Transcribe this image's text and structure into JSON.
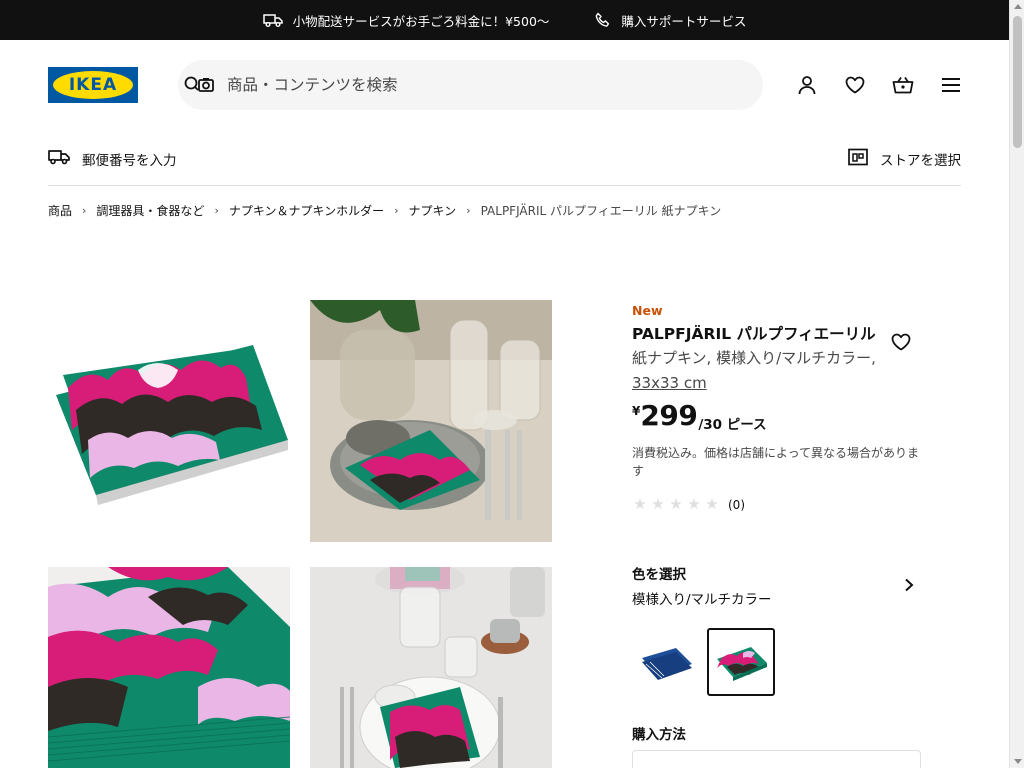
{
  "topbar": {
    "delivery_text": "小物配送サービスがお手ごろ料金に！¥500〜",
    "support_text": "購入サポートサービス"
  },
  "header": {
    "logo_text": "IKEA",
    "search_placeholder": "商品・コンテンツを検索",
    "postal_label": "郵便番号を入力",
    "store_label": "ストアを選択"
  },
  "breadcrumb": {
    "items": [
      "商品",
      "調理器具・食器など",
      "ナプキン＆ナプキンホルダー",
      "ナプキン"
    ],
    "current": "PALPFJÄRIL パルプフィエーリル 紙ナプキン"
  },
  "product": {
    "badge": "New",
    "name": "PALPFJÄRIL パルプフィエーリル",
    "description": "紙ナプキン, 模様入り/マルチカラー, ",
    "size": "33x33 cm",
    "currency": "¥",
    "price": "299",
    "unit": "/30 ピース",
    "tax_note": "消費税込み。価格は店舗によって異なる場合があります",
    "rating_count": "(0)",
    "rating_value": 0,
    "rating_max": 5
  },
  "color": {
    "title": "色を選択",
    "selected": "模様入り/マルチカラー"
  },
  "purchase": {
    "title": "購入方法"
  },
  "colors": {
    "topbar_bg": "#111111",
    "ikea_blue": "#0058a3",
    "ikea_yellow": "#ffdb00",
    "new_orange": "#ca5008",
    "napkin_green": "#0e8a6a",
    "napkin_pink": "#d81d78",
    "napkin_lilac": "#e9b6e6",
    "napkin_dark": "#2f2a26"
  }
}
